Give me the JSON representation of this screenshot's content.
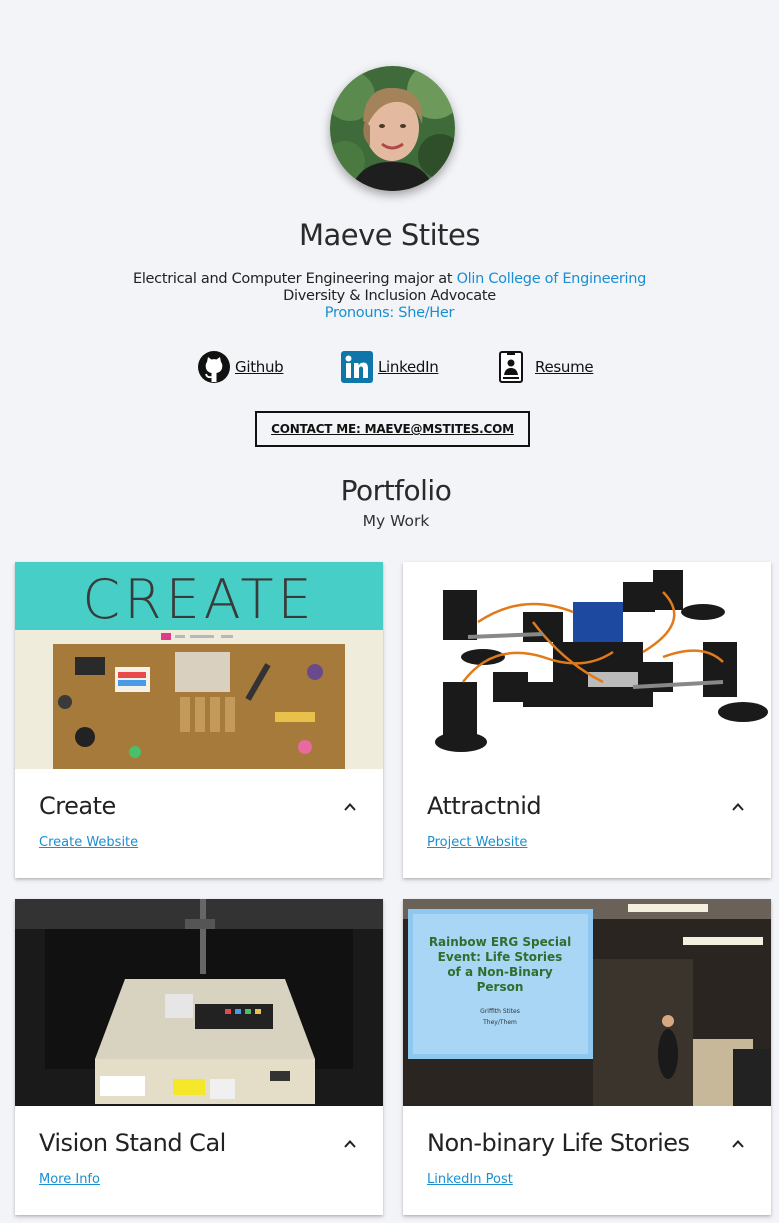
{
  "profile": {
    "name": "Maeve Stites",
    "tagline_prefix": "Electrical and Computer Engineering major at ",
    "school": "Olin College of Engineering",
    "role": "Diversity & Inclusion Advocate",
    "pronouns": "Pronouns: She/Her"
  },
  "social": {
    "github": "Github",
    "linkedin": "LinkedIn",
    "resume": "Resume"
  },
  "contact_label": "CONTACT ME: MAEVE@MSTITES.COM",
  "portfolio": {
    "title": "Portfolio",
    "subtitle": "My Work",
    "cards": [
      {
        "title": "Create",
        "link": "Create Website",
        "image_banner": "CREATE"
      },
      {
        "title": "Attractnid",
        "link": "Project Website"
      },
      {
        "title": "Vision Stand Cal",
        "link": "More Info"
      },
      {
        "title": "Non-binary Life Stories",
        "link": "LinkedIn Post",
        "slide_title": "Rainbow ERG Special Event: Life Stories of a Non-Binary Person",
        "slide_name": "Griffith Stites",
        "slide_pronouns": "They/Them"
      }
    ]
  },
  "colors": {
    "background": "#f3f4f8",
    "link": "#1a8fd0",
    "linkedin": "#0e76a8"
  }
}
